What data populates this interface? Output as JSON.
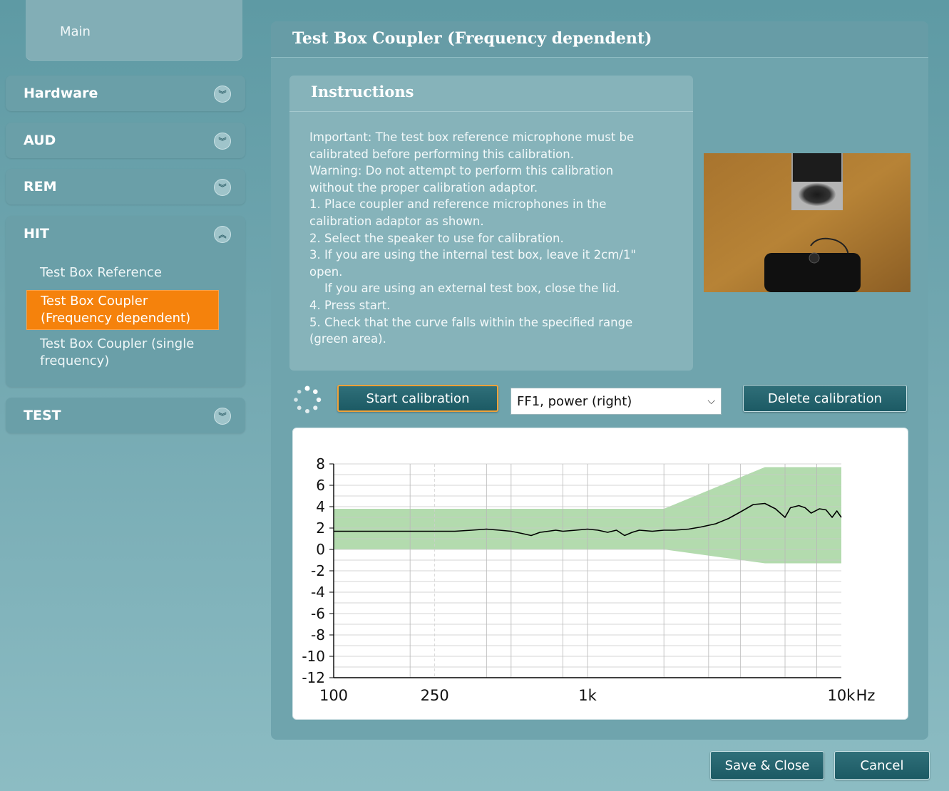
{
  "sidebar": {
    "main_label": "Main",
    "groups": [
      {
        "label": "Hardware",
        "chevron": "expand-icon"
      },
      {
        "label": "AUD",
        "chevron": "expand-icon"
      },
      {
        "label": "REM",
        "chevron": "expand-icon"
      },
      {
        "label": "HIT",
        "chevron": "collapse-icon"
      },
      {
        "label": "TEST",
        "chevron": "expand-icon"
      }
    ],
    "hit_items": [
      {
        "line1": "Test Box Reference",
        "line2": ""
      },
      {
        "line1": "Test Box Coupler",
        "line2": "(Frequency dependent)"
      },
      {
        "line1": "Test Box Coupler (single",
        "line2": "frequency)"
      }
    ]
  },
  "panel": {
    "title": "Test Box Coupler (Frequency dependent)",
    "instructions_title": "Instructions",
    "instructions": [
      "Important: The test box reference microphone must be",
      "calibrated before performing this calibration.",
      "Warning: Do not attempt to perform this calibration",
      "without the proper calibration adaptor.",
      "1. Place coupler and reference microphones in the",
      "calibration adaptor as shown.",
      "2. Select the speaker to use for calibration.",
      "3. If you are using the internal test box, leave it 2cm/1\"",
      "open.",
      "    If you are using an external test box, close the lid.",
      "4. Press start.",
      "5. Check that the curve falls within the specified range",
      "(green area)."
    ],
    "start_button": "Start calibration",
    "speaker_select": "FF1, power (right)",
    "delete_button": "Delete calibration"
  },
  "footer": {
    "save_button": "Save & Close",
    "cancel_button": "Cancel"
  },
  "colors": {
    "accent_active": "#f5820c",
    "tolerance_band": "#a6d5a0",
    "curve": "#000000"
  },
  "chart_data": {
    "type": "line",
    "x_scale": "log",
    "xlim": [
      100,
      10000
    ],
    "ylim": [
      -12,
      8
    ],
    "yticks": [
      8,
      6,
      4,
      2,
      0,
      -2,
      -4,
      -6,
      -8,
      -10,
      -12
    ],
    "xtick_labels": [
      {
        "x": 100,
        "label": "100"
      },
      {
        "x": 250,
        "label": "250"
      },
      {
        "x": 1000,
        "label": "1k"
      },
      {
        "x": 10000,
        "label": "10k"
      }
    ],
    "x_unit": "Hz",
    "grid": true,
    "tolerance_band": {
      "x": [
        100,
        2000,
        5000,
        10000
      ],
      "upper": [
        3.8,
        3.8,
        7.7,
        7.7
      ],
      "lower": [
        0.0,
        0.0,
        -1.3,
        -1.3
      ]
    },
    "series": [
      {
        "x": [
          100,
          120,
          150,
          200,
          250,
          300,
          350,
          400,
          450,
          500,
          550,
          600,
          650,
          700,
          750,
          800,
          900,
          1000,
          1100,
          1200,
          1300,
          1400,
          1500,
          1600,
          1800,
          2000,
          2200,
          2500,
          2800,
          3200,
          3600,
          4000,
          4500,
          5000,
          5500,
          6000,
          6300,
          6800,
          7200,
          7600,
          8200,
          8700,
          9200,
          9600,
          10000
        ],
        "y": [
          1.7,
          1.7,
          1.7,
          1.7,
          1.7,
          1.7,
          1.8,
          1.9,
          1.8,
          1.7,
          1.5,
          1.3,
          1.6,
          1.7,
          1.8,
          1.7,
          1.8,
          1.9,
          1.8,
          1.6,
          1.8,
          1.3,
          1.6,
          1.8,
          1.7,
          1.8,
          1.8,
          1.9,
          2.1,
          2.4,
          2.9,
          3.5,
          4.2,
          4.3,
          3.8,
          3.0,
          3.9,
          4.1,
          3.9,
          3.4,
          3.8,
          3.7,
          3.0,
          3.6,
          3.0
        ]
      }
    ]
  }
}
